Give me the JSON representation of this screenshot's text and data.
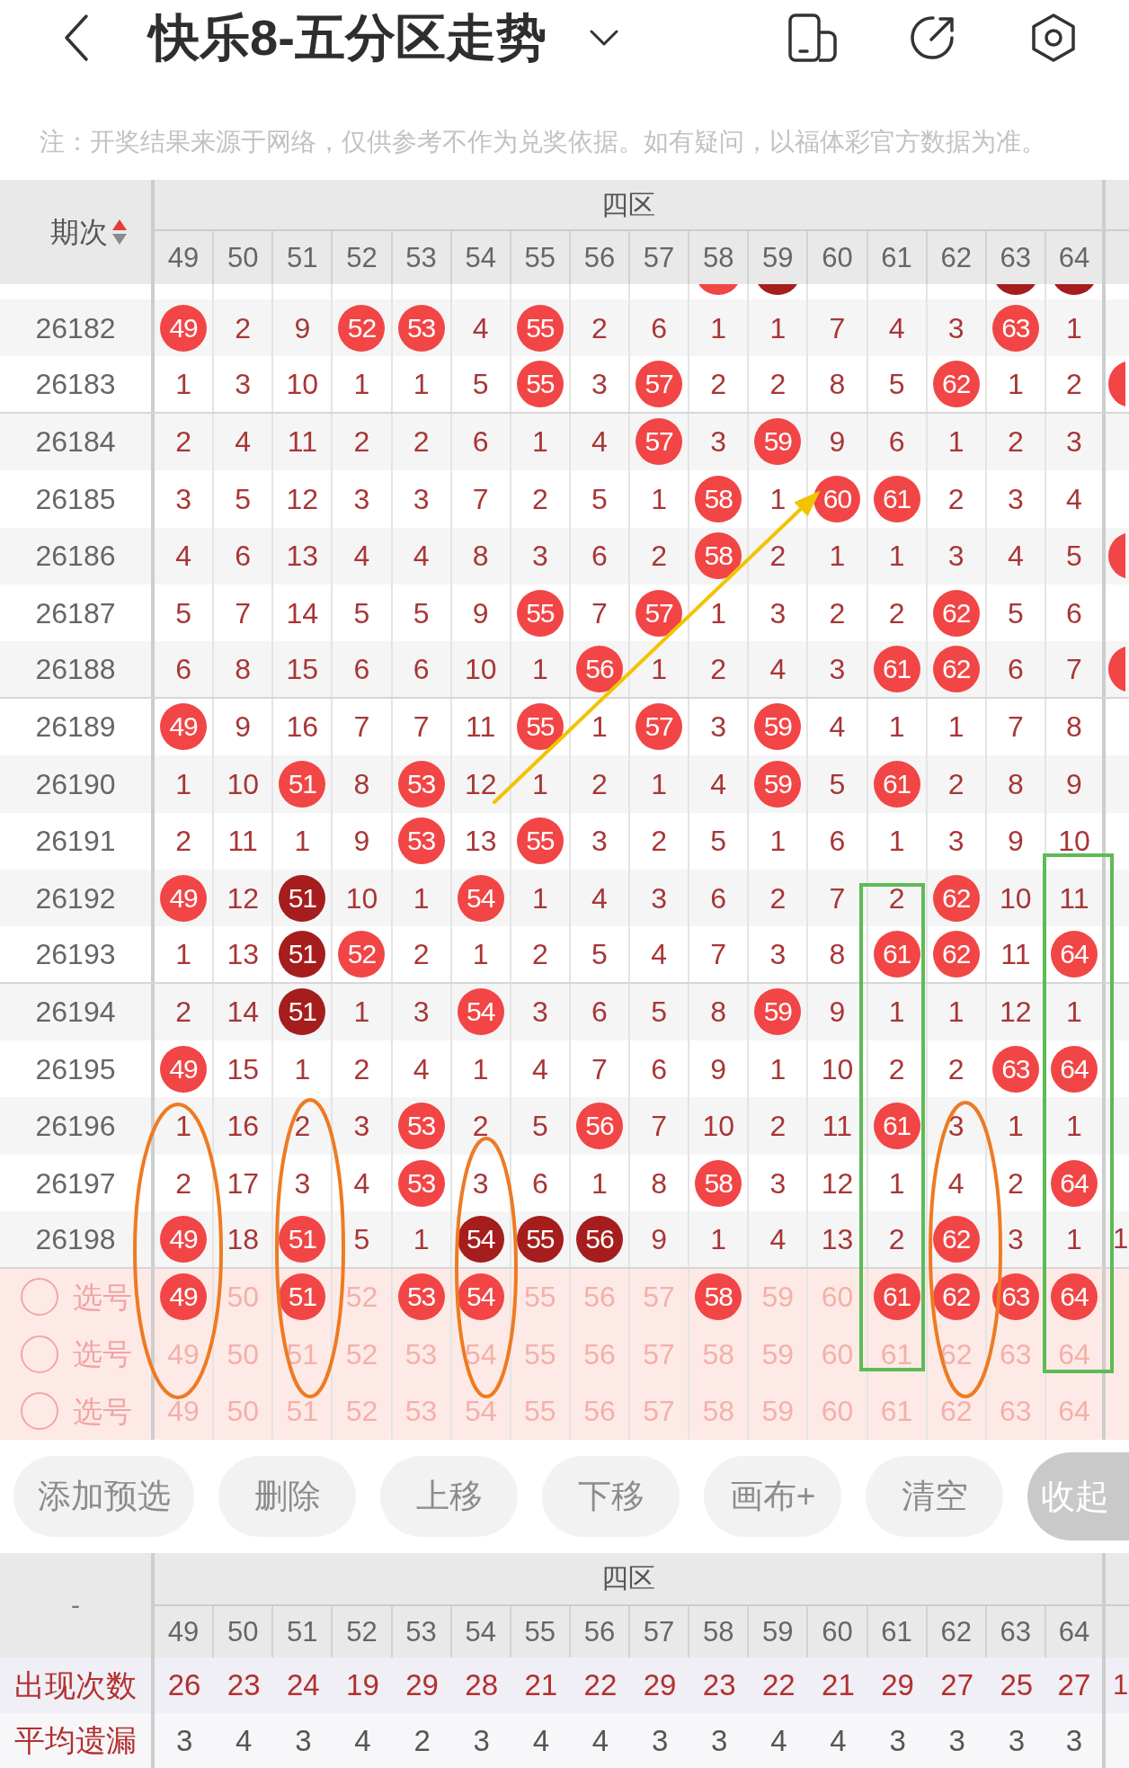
{
  "header": {
    "title": "快乐8-五分区走势"
  },
  "note": "注：开奖结果来源于网络，仅供参考不作为兑奖依据。如有疑问，以福体彩官方数据为准。",
  "trend_table": {
    "period_heading": "期次",
    "sort_ascending": true,
    "zone_heading": "四区",
    "columns": [
      "49",
      "50",
      "51",
      "52",
      "53",
      "54",
      "55",
      "56",
      "57",
      "58",
      "59",
      "60",
      "61",
      "62",
      "63",
      "64"
    ],
    "cut_row": [
      {
        "kind": "miss"
      },
      {
        "kind": "miss"
      },
      {
        "kind": "miss"
      },
      {
        "kind": "miss"
      },
      {
        "kind": "miss"
      },
      {
        "kind": "miss"
      },
      {
        "kind": "miss"
      },
      {
        "kind": "miss"
      },
      {
        "kind": "miss"
      },
      {
        "kind": "hit"
      },
      {
        "kind": "dark"
      },
      {
        "kind": "miss"
      },
      {
        "kind": "miss"
      },
      {
        "kind": "miss"
      },
      {
        "kind": "dark"
      },
      {
        "kind": "dark"
      }
    ],
    "rows": [
      {
        "period": "26182",
        "cells": [
          {
            "text": "49",
            "kind": "hit"
          },
          {
            "text": "2",
            "kind": "miss"
          },
          {
            "text": "9",
            "kind": "miss"
          },
          {
            "text": "52",
            "kind": "hit"
          },
          {
            "text": "53",
            "kind": "hit"
          },
          {
            "text": "4",
            "kind": "miss"
          },
          {
            "text": "55",
            "kind": "hit"
          },
          {
            "text": "2",
            "kind": "miss"
          },
          {
            "text": "6",
            "kind": "miss"
          },
          {
            "text": "1",
            "kind": "miss"
          },
          {
            "text": "1",
            "kind": "miss"
          },
          {
            "text": "7",
            "kind": "miss"
          },
          {
            "text": "4",
            "kind": "miss"
          },
          {
            "text": "3",
            "kind": "miss"
          },
          {
            "text": "63",
            "kind": "hit"
          },
          {
            "text": "1",
            "kind": "miss"
          }
        ],
        "edge": {
          "kind": "miss"
        }
      },
      {
        "period": "26183",
        "cells": [
          {
            "text": "1",
            "kind": "miss"
          },
          {
            "text": "3",
            "kind": "miss"
          },
          {
            "text": "10",
            "kind": "miss"
          },
          {
            "text": "1",
            "kind": "miss"
          },
          {
            "text": "1",
            "kind": "miss"
          },
          {
            "text": "5",
            "kind": "miss"
          },
          {
            "text": "55",
            "kind": "hit"
          },
          {
            "text": "3",
            "kind": "miss"
          },
          {
            "text": "57",
            "kind": "hit"
          },
          {
            "text": "2",
            "kind": "miss"
          },
          {
            "text": "2",
            "kind": "miss"
          },
          {
            "text": "8",
            "kind": "miss"
          },
          {
            "text": "5",
            "kind": "miss"
          },
          {
            "text": "62",
            "kind": "hit"
          },
          {
            "text": "1",
            "kind": "miss"
          },
          {
            "text": "2",
            "kind": "miss"
          }
        ],
        "edge": {
          "kind": "hit"
        }
      },
      {
        "period": "26184",
        "cells": [
          {
            "text": "2",
            "kind": "miss"
          },
          {
            "text": "4",
            "kind": "miss"
          },
          {
            "text": "11",
            "kind": "miss"
          },
          {
            "text": "2",
            "kind": "miss"
          },
          {
            "text": "2",
            "kind": "miss"
          },
          {
            "text": "6",
            "kind": "miss"
          },
          {
            "text": "1",
            "kind": "miss"
          },
          {
            "text": "4",
            "kind": "miss"
          },
          {
            "text": "57",
            "kind": "hit"
          },
          {
            "text": "3",
            "kind": "miss"
          },
          {
            "text": "59",
            "kind": "hit"
          },
          {
            "text": "9",
            "kind": "miss"
          },
          {
            "text": "6",
            "kind": "miss"
          },
          {
            "text": "1",
            "kind": "miss"
          },
          {
            "text": "2",
            "kind": "miss"
          },
          {
            "text": "3",
            "kind": "miss"
          }
        ],
        "edge": {
          "kind": "miss"
        }
      },
      {
        "period": "26185",
        "cells": [
          {
            "text": "3",
            "kind": "miss"
          },
          {
            "text": "5",
            "kind": "miss"
          },
          {
            "text": "12",
            "kind": "miss"
          },
          {
            "text": "3",
            "kind": "miss"
          },
          {
            "text": "3",
            "kind": "miss"
          },
          {
            "text": "7",
            "kind": "miss"
          },
          {
            "text": "2",
            "kind": "miss"
          },
          {
            "text": "5",
            "kind": "miss"
          },
          {
            "text": "1",
            "kind": "miss"
          },
          {
            "text": "58",
            "kind": "hit"
          },
          {
            "text": "1",
            "kind": "miss"
          },
          {
            "text": "60",
            "kind": "hit"
          },
          {
            "text": "61",
            "kind": "hit"
          },
          {
            "text": "2",
            "kind": "miss"
          },
          {
            "text": "3",
            "kind": "miss"
          },
          {
            "text": "4",
            "kind": "miss"
          }
        ],
        "edge": {
          "kind": "miss"
        }
      },
      {
        "period": "26186",
        "cells": [
          {
            "text": "4",
            "kind": "miss"
          },
          {
            "text": "6",
            "kind": "miss"
          },
          {
            "text": "13",
            "kind": "miss"
          },
          {
            "text": "4",
            "kind": "miss"
          },
          {
            "text": "4",
            "kind": "miss"
          },
          {
            "text": "8",
            "kind": "miss"
          },
          {
            "text": "3",
            "kind": "miss"
          },
          {
            "text": "6",
            "kind": "miss"
          },
          {
            "text": "2",
            "kind": "miss"
          },
          {
            "text": "58",
            "kind": "hit"
          },
          {
            "text": "2",
            "kind": "miss"
          },
          {
            "text": "1",
            "kind": "miss"
          },
          {
            "text": "1",
            "kind": "miss"
          },
          {
            "text": "3",
            "kind": "miss"
          },
          {
            "text": "4",
            "kind": "miss"
          },
          {
            "text": "5",
            "kind": "miss"
          }
        ],
        "edge": {
          "kind": "hit"
        }
      },
      {
        "period": "26187",
        "cells": [
          {
            "text": "5",
            "kind": "miss"
          },
          {
            "text": "7",
            "kind": "miss"
          },
          {
            "text": "14",
            "kind": "miss"
          },
          {
            "text": "5",
            "kind": "miss"
          },
          {
            "text": "5",
            "kind": "miss"
          },
          {
            "text": "9",
            "kind": "miss"
          },
          {
            "text": "55",
            "kind": "hit"
          },
          {
            "text": "7",
            "kind": "miss"
          },
          {
            "text": "57",
            "kind": "hit"
          },
          {
            "text": "1",
            "kind": "miss"
          },
          {
            "text": "3",
            "kind": "miss"
          },
          {
            "text": "2",
            "kind": "miss"
          },
          {
            "text": "2",
            "kind": "miss"
          },
          {
            "text": "62",
            "kind": "hit"
          },
          {
            "text": "5",
            "kind": "miss"
          },
          {
            "text": "6",
            "kind": "miss"
          }
        ],
        "edge": {
          "kind": "miss"
        }
      },
      {
        "period": "26188",
        "cells": [
          {
            "text": "6",
            "kind": "miss"
          },
          {
            "text": "8",
            "kind": "miss"
          },
          {
            "text": "15",
            "kind": "miss"
          },
          {
            "text": "6",
            "kind": "miss"
          },
          {
            "text": "6",
            "kind": "miss"
          },
          {
            "text": "10",
            "kind": "miss"
          },
          {
            "text": "1",
            "kind": "miss"
          },
          {
            "text": "56",
            "kind": "hit"
          },
          {
            "text": "1",
            "kind": "miss"
          },
          {
            "text": "2",
            "kind": "miss"
          },
          {
            "text": "4",
            "kind": "miss"
          },
          {
            "text": "3",
            "kind": "miss"
          },
          {
            "text": "61",
            "kind": "hit"
          },
          {
            "text": "62",
            "kind": "hit"
          },
          {
            "text": "6",
            "kind": "miss"
          },
          {
            "text": "7",
            "kind": "miss"
          }
        ],
        "edge": {
          "kind": "hit"
        }
      },
      {
        "period": "26189",
        "cells": [
          {
            "text": "49",
            "kind": "hit"
          },
          {
            "text": "9",
            "kind": "miss"
          },
          {
            "text": "16",
            "kind": "miss"
          },
          {
            "text": "7",
            "kind": "miss"
          },
          {
            "text": "7",
            "kind": "miss"
          },
          {
            "text": "11",
            "kind": "miss"
          },
          {
            "text": "55",
            "kind": "hit"
          },
          {
            "text": "1",
            "kind": "miss"
          },
          {
            "text": "57",
            "kind": "hit"
          },
          {
            "text": "3",
            "kind": "miss"
          },
          {
            "text": "59",
            "kind": "hit"
          },
          {
            "text": "4",
            "kind": "miss"
          },
          {
            "text": "1",
            "kind": "miss"
          },
          {
            "text": "1",
            "kind": "miss"
          },
          {
            "text": "7",
            "kind": "miss"
          },
          {
            "text": "8",
            "kind": "miss"
          }
        ],
        "edge": {
          "kind": "miss"
        }
      },
      {
        "period": "26190",
        "cells": [
          {
            "text": "1",
            "kind": "miss"
          },
          {
            "text": "10",
            "kind": "miss"
          },
          {
            "text": "51",
            "kind": "hit"
          },
          {
            "text": "8",
            "kind": "miss"
          },
          {
            "text": "53",
            "kind": "hit"
          },
          {
            "text": "12",
            "kind": "miss"
          },
          {
            "text": "1",
            "kind": "miss"
          },
          {
            "text": "2",
            "kind": "miss"
          },
          {
            "text": "1",
            "kind": "miss"
          },
          {
            "text": "4",
            "kind": "miss"
          },
          {
            "text": "59",
            "kind": "hit"
          },
          {
            "text": "5",
            "kind": "miss"
          },
          {
            "text": "61",
            "kind": "hit"
          },
          {
            "text": "2",
            "kind": "miss"
          },
          {
            "text": "8",
            "kind": "miss"
          },
          {
            "text": "9",
            "kind": "miss"
          }
        ],
        "edge": {
          "kind": "miss"
        }
      },
      {
        "period": "26191",
        "cells": [
          {
            "text": "2",
            "kind": "miss"
          },
          {
            "text": "11",
            "kind": "miss"
          },
          {
            "text": "1",
            "kind": "miss"
          },
          {
            "text": "9",
            "kind": "miss"
          },
          {
            "text": "53",
            "kind": "hit"
          },
          {
            "text": "13",
            "kind": "miss"
          },
          {
            "text": "55",
            "kind": "hit"
          },
          {
            "text": "3",
            "kind": "miss"
          },
          {
            "text": "2",
            "kind": "miss"
          },
          {
            "text": "5",
            "kind": "miss"
          },
          {
            "text": "1",
            "kind": "miss"
          },
          {
            "text": "6",
            "kind": "miss"
          },
          {
            "text": "1",
            "kind": "miss"
          },
          {
            "text": "3",
            "kind": "miss"
          },
          {
            "text": "9",
            "kind": "miss"
          },
          {
            "text": "10",
            "kind": "miss"
          }
        ],
        "edge": {
          "kind": "miss"
        }
      },
      {
        "period": "26192",
        "cells": [
          {
            "text": "49",
            "kind": "hit"
          },
          {
            "text": "12",
            "kind": "miss"
          },
          {
            "text": "51",
            "kind": "dark"
          },
          {
            "text": "10",
            "kind": "miss"
          },
          {
            "text": "1",
            "kind": "miss"
          },
          {
            "text": "54",
            "kind": "hit"
          },
          {
            "text": "1",
            "kind": "miss"
          },
          {
            "text": "4",
            "kind": "miss"
          },
          {
            "text": "3",
            "kind": "miss"
          },
          {
            "text": "6",
            "kind": "miss"
          },
          {
            "text": "2",
            "kind": "miss"
          },
          {
            "text": "7",
            "kind": "miss"
          },
          {
            "text": "2",
            "kind": "miss"
          },
          {
            "text": "62",
            "kind": "hit"
          },
          {
            "text": "10",
            "kind": "miss"
          },
          {
            "text": "11",
            "kind": "miss"
          }
        ],
        "edge": {
          "kind": "miss"
        }
      },
      {
        "period": "26193",
        "cells": [
          {
            "text": "1",
            "kind": "miss"
          },
          {
            "text": "13",
            "kind": "miss"
          },
          {
            "text": "51",
            "kind": "dark"
          },
          {
            "text": "52",
            "kind": "hit"
          },
          {
            "text": "2",
            "kind": "miss"
          },
          {
            "text": "1",
            "kind": "miss"
          },
          {
            "text": "2",
            "kind": "miss"
          },
          {
            "text": "5",
            "kind": "miss"
          },
          {
            "text": "4",
            "kind": "miss"
          },
          {
            "text": "7",
            "kind": "miss"
          },
          {
            "text": "3",
            "kind": "miss"
          },
          {
            "text": "8",
            "kind": "miss"
          },
          {
            "text": "61",
            "kind": "hit"
          },
          {
            "text": "62",
            "kind": "hit"
          },
          {
            "text": "11",
            "kind": "miss"
          },
          {
            "text": "64",
            "kind": "hit"
          }
        ],
        "edge": {
          "kind": "miss"
        }
      },
      {
        "period": "26194",
        "cells": [
          {
            "text": "2",
            "kind": "miss"
          },
          {
            "text": "14",
            "kind": "miss"
          },
          {
            "text": "51",
            "kind": "dark"
          },
          {
            "text": "1",
            "kind": "miss"
          },
          {
            "text": "3",
            "kind": "miss"
          },
          {
            "text": "54",
            "kind": "hit"
          },
          {
            "text": "3",
            "kind": "miss"
          },
          {
            "text": "6",
            "kind": "miss"
          },
          {
            "text": "5",
            "kind": "miss"
          },
          {
            "text": "8",
            "kind": "miss"
          },
          {
            "text": "59",
            "kind": "hit"
          },
          {
            "text": "9",
            "kind": "miss"
          },
          {
            "text": "1",
            "kind": "miss"
          },
          {
            "text": "1",
            "kind": "miss"
          },
          {
            "text": "12",
            "kind": "miss"
          },
          {
            "text": "1",
            "kind": "miss"
          }
        ],
        "edge": {
          "kind": "miss"
        }
      },
      {
        "period": "26195",
        "cells": [
          {
            "text": "49",
            "kind": "hit"
          },
          {
            "text": "15",
            "kind": "miss"
          },
          {
            "text": "1",
            "kind": "miss"
          },
          {
            "text": "2",
            "kind": "miss"
          },
          {
            "text": "4",
            "kind": "miss"
          },
          {
            "text": "1",
            "kind": "miss"
          },
          {
            "text": "4",
            "kind": "miss"
          },
          {
            "text": "7",
            "kind": "miss"
          },
          {
            "text": "6",
            "kind": "miss"
          },
          {
            "text": "9",
            "kind": "miss"
          },
          {
            "text": "1",
            "kind": "miss"
          },
          {
            "text": "10",
            "kind": "miss"
          },
          {
            "text": "2",
            "kind": "miss"
          },
          {
            "text": "2",
            "kind": "miss"
          },
          {
            "text": "63",
            "kind": "hit"
          },
          {
            "text": "64",
            "kind": "hit"
          }
        ],
        "edge": {
          "kind": "miss"
        }
      },
      {
        "period": "26196",
        "cells": [
          {
            "text": "1",
            "kind": "miss"
          },
          {
            "text": "16",
            "kind": "miss"
          },
          {
            "text": "2",
            "kind": "miss"
          },
          {
            "text": "3",
            "kind": "miss"
          },
          {
            "text": "53",
            "kind": "hit"
          },
          {
            "text": "2",
            "kind": "miss"
          },
          {
            "text": "5",
            "kind": "miss"
          },
          {
            "text": "56",
            "kind": "hit"
          },
          {
            "text": "7",
            "kind": "miss"
          },
          {
            "text": "10",
            "kind": "miss"
          },
          {
            "text": "2",
            "kind": "miss"
          },
          {
            "text": "11",
            "kind": "miss"
          },
          {
            "text": "61",
            "kind": "hit"
          },
          {
            "text": "3",
            "kind": "miss"
          },
          {
            "text": "1",
            "kind": "miss"
          },
          {
            "text": "1",
            "kind": "miss"
          }
        ],
        "edge": {
          "kind": "miss"
        }
      },
      {
        "period": "26197",
        "cells": [
          {
            "text": "2",
            "kind": "miss"
          },
          {
            "text": "17",
            "kind": "miss"
          },
          {
            "text": "3",
            "kind": "miss"
          },
          {
            "text": "4",
            "kind": "miss"
          },
          {
            "text": "53",
            "kind": "hit"
          },
          {
            "text": "3",
            "kind": "miss"
          },
          {
            "text": "6",
            "kind": "miss"
          },
          {
            "text": "1",
            "kind": "miss"
          },
          {
            "text": "8",
            "kind": "miss"
          },
          {
            "text": "58",
            "kind": "hit"
          },
          {
            "text": "3",
            "kind": "miss"
          },
          {
            "text": "12",
            "kind": "miss"
          },
          {
            "text": "1",
            "kind": "miss"
          },
          {
            "text": "4",
            "kind": "miss"
          },
          {
            "text": "2",
            "kind": "miss"
          },
          {
            "text": "64",
            "kind": "hit"
          }
        ],
        "edge": {
          "kind": "miss"
        }
      },
      {
        "period": "26198",
        "cells": [
          {
            "text": "49",
            "kind": "hit"
          },
          {
            "text": "18",
            "kind": "miss"
          },
          {
            "text": "51",
            "kind": "hit"
          },
          {
            "text": "5",
            "kind": "miss"
          },
          {
            "text": "1",
            "kind": "miss"
          },
          {
            "text": "54",
            "kind": "dark"
          },
          {
            "text": "55",
            "kind": "dark"
          },
          {
            "text": "56",
            "kind": "dark"
          },
          {
            "text": "9",
            "kind": "miss"
          },
          {
            "text": "1",
            "kind": "miss"
          },
          {
            "text": "4",
            "kind": "miss"
          },
          {
            "text": "13",
            "kind": "miss"
          },
          {
            "text": "2",
            "kind": "miss"
          },
          {
            "text": "62",
            "kind": "hit"
          },
          {
            "text": "3",
            "kind": "miss"
          },
          {
            "text": "1",
            "kind": "miss"
          }
        ],
        "edge": {
          "kind": "miss",
          "text": "1"
        }
      }
    ],
    "pick_rows": [
      {
        "label": "选号",
        "selected": false,
        "cells": [
          {
            "text": "49",
            "kind": "hit"
          },
          {
            "text": "50",
            "kind": "miss"
          },
          {
            "text": "51",
            "kind": "hit"
          },
          {
            "text": "52",
            "kind": "miss"
          },
          {
            "text": "53",
            "kind": "hit"
          },
          {
            "text": "54",
            "kind": "hit"
          },
          {
            "text": "55",
            "kind": "miss"
          },
          {
            "text": "56",
            "kind": "miss"
          },
          {
            "text": "57",
            "kind": "miss"
          },
          {
            "text": "58",
            "kind": "hit"
          },
          {
            "text": "59",
            "kind": "miss"
          },
          {
            "text": "60",
            "kind": "miss"
          },
          {
            "text": "61",
            "kind": "hit"
          },
          {
            "text": "62",
            "kind": "hit"
          },
          {
            "text": "63",
            "kind": "hit"
          },
          {
            "text": "64",
            "kind": "hit"
          }
        ]
      },
      {
        "label": "选号",
        "selected": false,
        "cells": [
          {
            "text": "49",
            "kind": "miss"
          },
          {
            "text": "50",
            "kind": "miss"
          },
          {
            "text": "51",
            "kind": "miss"
          },
          {
            "text": "52",
            "kind": "miss"
          },
          {
            "text": "53",
            "kind": "miss"
          },
          {
            "text": "54",
            "kind": "miss"
          },
          {
            "text": "55",
            "kind": "miss"
          },
          {
            "text": "56",
            "kind": "miss"
          },
          {
            "text": "57",
            "kind": "miss"
          },
          {
            "text": "58",
            "kind": "miss"
          },
          {
            "text": "59",
            "kind": "miss"
          },
          {
            "text": "60",
            "kind": "miss"
          },
          {
            "text": "61",
            "kind": "miss"
          },
          {
            "text": "62",
            "kind": "miss"
          },
          {
            "text": "63",
            "kind": "miss"
          },
          {
            "text": "64",
            "kind": "miss"
          }
        ]
      },
      {
        "label": "选号",
        "selected": false,
        "cells": [
          {
            "text": "49",
            "kind": "miss"
          },
          {
            "text": "50",
            "kind": "miss"
          },
          {
            "text": "51",
            "kind": "miss"
          },
          {
            "text": "52",
            "kind": "miss"
          },
          {
            "text": "53",
            "kind": "miss"
          },
          {
            "text": "54",
            "kind": "miss"
          },
          {
            "text": "55",
            "kind": "miss"
          },
          {
            "text": "56",
            "kind": "miss"
          },
          {
            "text": "57",
            "kind": "miss"
          },
          {
            "text": "58",
            "kind": "miss"
          },
          {
            "text": "59",
            "kind": "miss"
          },
          {
            "text": "60",
            "kind": "miss"
          },
          {
            "text": "61",
            "kind": "miss"
          },
          {
            "text": "62",
            "kind": "miss"
          },
          {
            "text": "63",
            "kind": "miss"
          },
          {
            "text": "64",
            "kind": "miss"
          }
        ]
      }
    ]
  },
  "buttons": [
    {
      "label": "添加预选",
      "kind": "action"
    },
    {
      "label": "删除",
      "kind": "action"
    },
    {
      "label": "上移",
      "kind": "action"
    },
    {
      "label": "下移",
      "kind": "action"
    },
    {
      "label": "画布+",
      "kind": "action"
    },
    {
      "label": "清空",
      "kind": "action"
    },
    {
      "label": "收起",
      "kind": "toggle"
    }
  ],
  "stats_table": {
    "corner": "-",
    "zone_heading": "四区",
    "columns": [
      "49",
      "50",
      "51",
      "52",
      "53",
      "54",
      "55",
      "56",
      "57",
      "58",
      "59",
      "60",
      "61",
      "62",
      "63",
      "64"
    ],
    "rows": [
      {
        "label": "出现次数",
        "kind": "count",
        "values": [
          "26",
          "23",
          "24",
          "19",
          "29",
          "28",
          "21",
          "22",
          "29",
          "23",
          "22",
          "21",
          "29",
          "27",
          "25",
          "27"
        ],
        "edge_value": "1"
      },
      {
        "label": "平均遗漏",
        "kind": "gap",
        "values": [
          "3",
          "4",
          "3",
          "4",
          "2",
          "3",
          "4",
          "4",
          "3",
          "3",
          "4",
          "4",
          "3",
          "3",
          "3",
          "3"
        ]
      }
    ]
  }
}
